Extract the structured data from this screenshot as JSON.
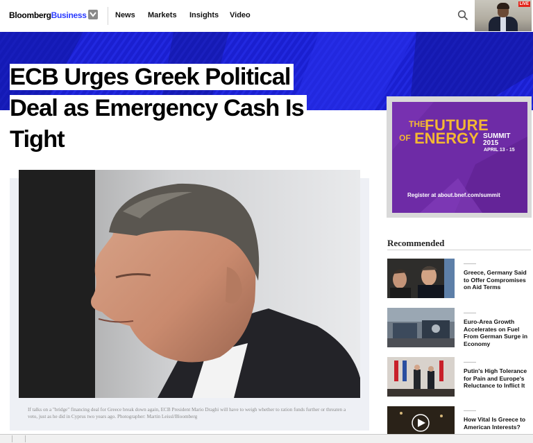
{
  "brand": {
    "part1": "Bloomberg",
    "part2": "Business"
  },
  "nav": {
    "items": [
      "News",
      "Markets",
      "Insights",
      "Video"
    ]
  },
  "live": {
    "badge": "LIVE"
  },
  "article": {
    "headline_lines": [
      "ECB Urges Greek Political",
      "Deal as Emergency Cash Is",
      "Tight"
    ],
    "caption": "If talks on a \"bridge\" financing deal for Greece break down again, ECB President Mario Draghi will have to weigh whether to ration funds further or threaten a veto, just as he did in Cyprus two years ago. Photographer: Martin Leissl/Bloomberg"
  },
  "ad": {
    "the": "THE",
    "future": "FUTURE",
    "of": "OF",
    "energy": "ENERGY",
    "summit": "SUMMIT",
    "year": "2015",
    "dates": "APRIL 13 - 15",
    "register": "Register at about.bnef.com/summit"
  },
  "recommended": {
    "title": "Recommended",
    "items": [
      {
        "text": "Greece, Germany Said to Offer Compromises on Aid Terms"
      },
      {
        "text": "Euro-Area Growth Accelerates on Fuel From German Surge in Economy"
      },
      {
        "text": "Putin's High Tolerance for Pain and Europe's Reluctance to Inflict It"
      },
      {
        "text": "How Vital Is Greece to American Interests?"
      }
    ]
  },
  "colors": {
    "brand_blue": "#2b3cff",
    "hero_blue": "#1a1fd0",
    "ad_purple": "#6e2ba6",
    "ad_gold": "#f4b832",
    "live_red": "#e2231a"
  }
}
